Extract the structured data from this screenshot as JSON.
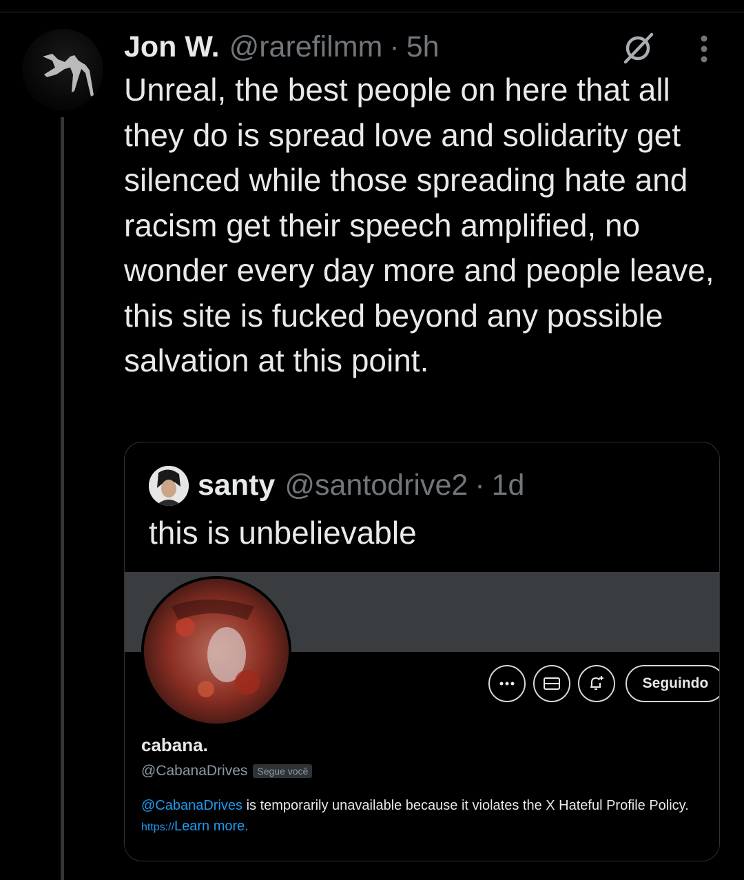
{
  "tweet": {
    "author_name": "Jon W.",
    "handle": "@rarefilmm",
    "separator": "·",
    "time": "5h",
    "text": "Unreal, the best people on here that all they do is spread love and solidarity get silenced while those spreading hate and racism get their speech amplified, no wonder every day more and people leave, this site is fucked beyond any possible salvation at this point."
  },
  "quoted_tweet": {
    "author_name": "santy",
    "handle": "@santodrive2",
    "separator": "·",
    "time": "1d",
    "text": "this is unbelievable"
  },
  "screenshot_profile": {
    "name": "cabana.",
    "handle": "@CabanaDrives",
    "follows_you_badge": "Segue você",
    "follow_button_label": "Seguindo",
    "notice_handle": "@CabanaDrives",
    "notice_text": " is temporarily unavailable because it violates the X Hateful Profile Policy. ",
    "notice_link_prefix": "https://",
    "notice_link_text": "Learn more."
  },
  "icons": {
    "grok": "grok-icon",
    "more": "more-options-icon",
    "profile_more": "ellipsis-icon",
    "message": "envelope-icon",
    "notify": "bell-plus-icon"
  },
  "colors": {
    "background": "#000000",
    "text": "#e7e9ea",
    "secondary": "#71767b",
    "link": "#1d9bf0",
    "border": "#2f3336"
  }
}
